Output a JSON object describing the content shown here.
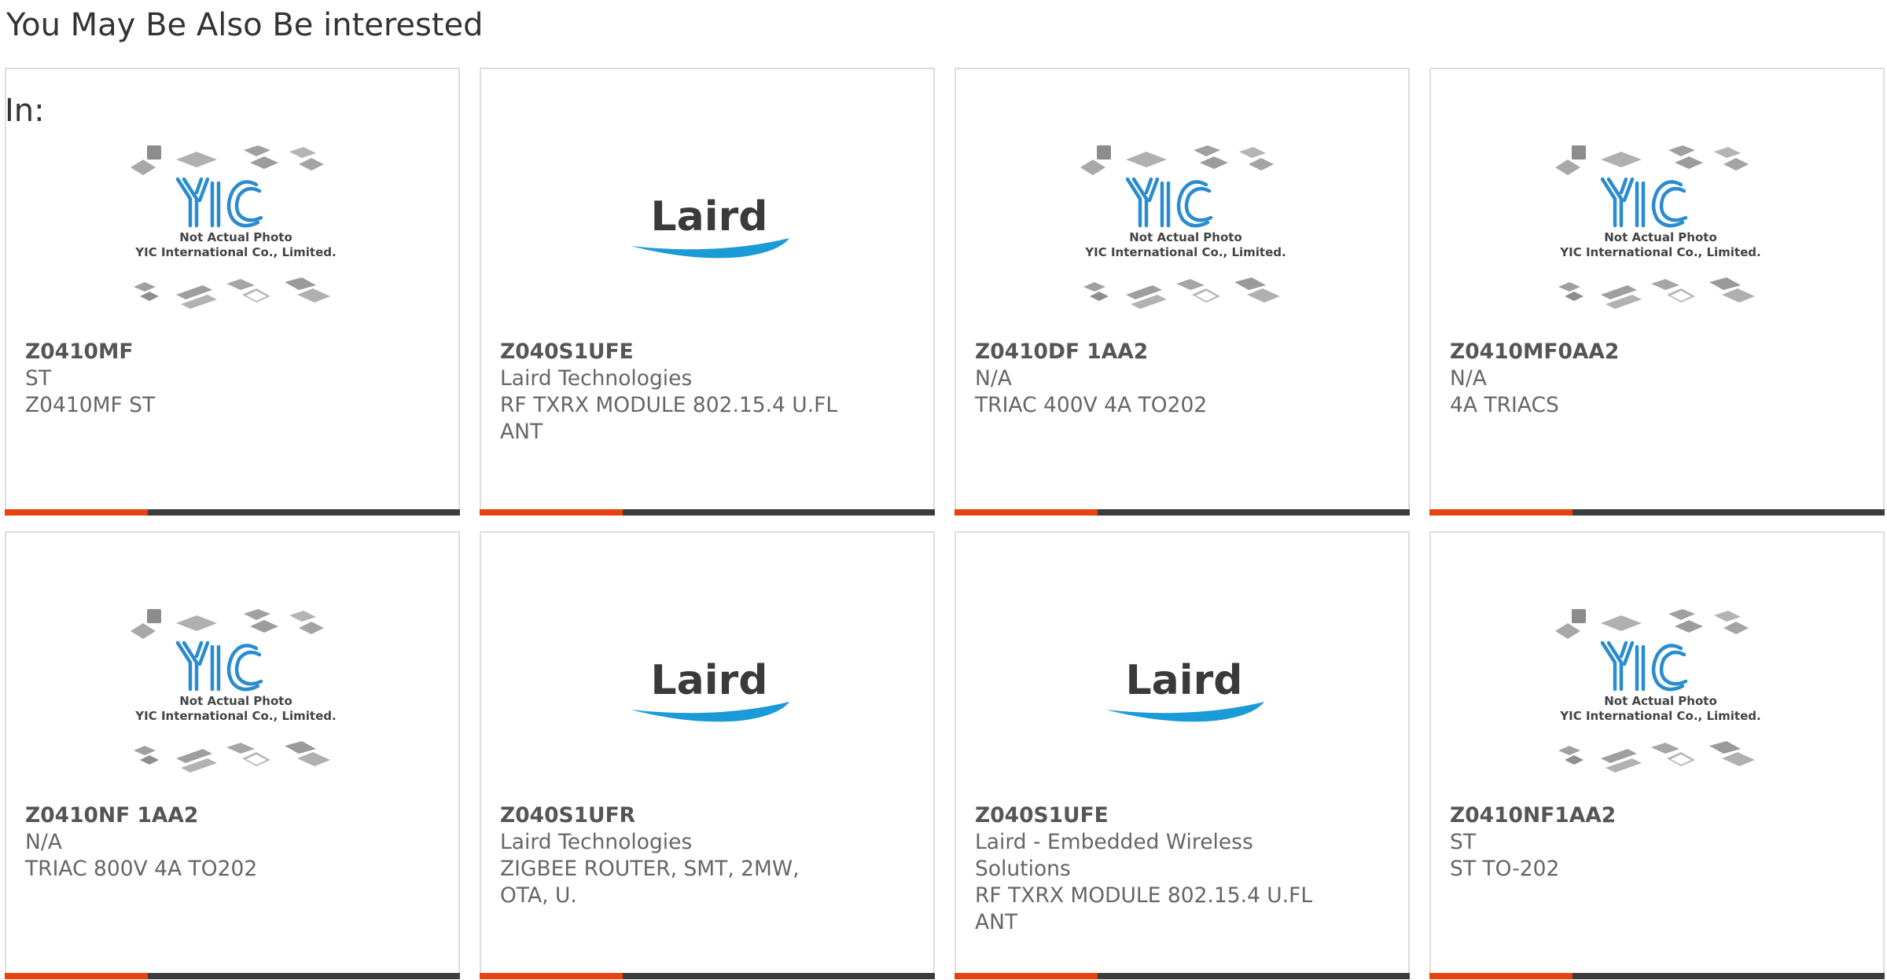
{
  "section": {
    "heading": "You May Be Also Be interested",
    "in_label": "In:"
  },
  "placeholder": {
    "line1": "Not Actual Photo",
    "line2": "YIC International Co., Limited.",
    "logo_text": "YIC"
  },
  "laird_logo_text": "Laird",
  "colors": {
    "accent": "#e8420f",
    "bar": "#3c3c3c",
    "yic_blue": "#1e8ac8",
    "laird_blue": "#1a9ad6"
  },
  "products": [
    {
      "part": "Z0410MF",
      "manufacturer": "ST",
      "description": "Z0410MF ST",
      "image": "yic-placeholder"
    },
    {
      "part": "Z040S1UFE",
      "manufacturer": "Laird Technologies",
      "description": "RF TXRX MODULE 802.15.4 U.FL ANT",
      "image": "laird-logo"
    },
    {
      "part": "Z0410DF 1AA2",
      "manufacturer": "N/A",
      "description": "TRIAC 400V 4A TO202",
      "image": "yic-placeholder"
    },
    {
      "part": "Z0410MF0AA2",
      "manufacturer": "N/A",
      "description": "4A TRIACS",
      "image": "yic-placeholder"
    },
    {
      "part": "Z0410NF 1AA2",
      "manufacturer": "N/A",
      "description": "TRIAC 800V 4A TO202",
      "image": "yic-placeholder"
    },
    {
      "part": "Z040S1UFR",
      "manufacturer": "Laird Technologies",
      "description": "ZIGBEE ROUTER, SMT, 2MW, OTA, U.",
      "image": "laird-logo"
    },
    {
      "part": "Z040S1UFE",
      "manufacturer": "Laird - Embedded Wireless Solutions",
      "description": "RF TXRX MODULE 802.15.4 U.FL ANT",
      "image": "laird-logo"
    },
    {
      "part": "Z0410NF1AA2",
      "manufacturer": "ST",
      "description": "ST TO-202",
      "image": "yic-placeholder"
    }
  ]
}
